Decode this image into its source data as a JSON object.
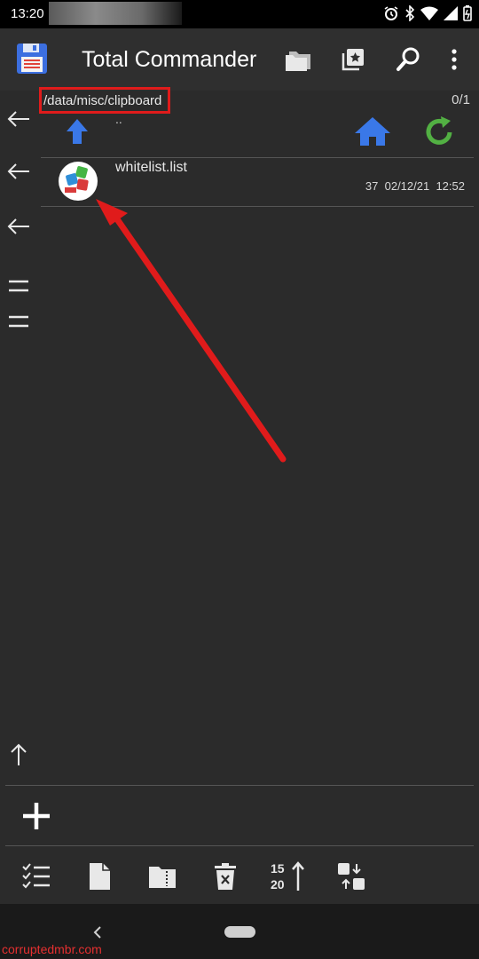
{
  "status_bar": {
    "time": "13:20"
  },
  "app": {
    "title": "Total Commander"
  },
  "panel": {
    "path": "/data/misc/clipboard",
    "selection_count": "0/1",
    "parent_label": ".."
  },
  "files": [
    {
      "name": "whitelist.list",
      "size": "37",
      "date": "02/12/21",
      "time": "12:52"
    }
  ],
  "watermark": "corruptedmbr.com",
  "colors": {
    "annotation": "#e01b1b",
    "accent_blue": "#3a78e8",
    "accent_green": "#52b043"
  }
}
